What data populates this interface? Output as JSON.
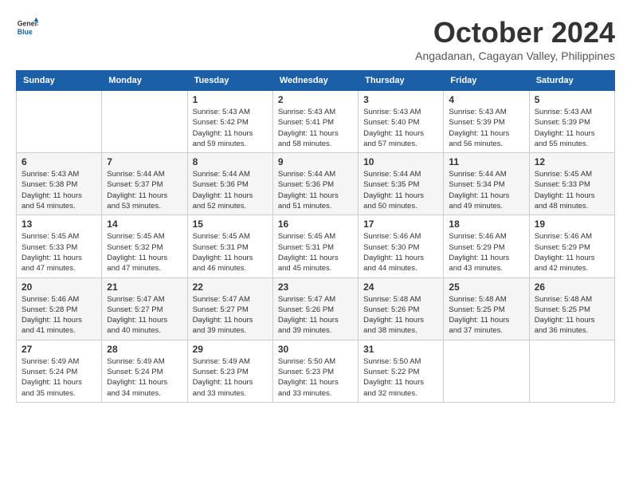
{
  "header": {
    "logo_line1": "General",
    "logo_line2": "Blue",
    "month": "October 2024",
    "location": "Angadanan, Cagayan Valley, Philippines"
  },
  "weekdays": [
    "Sunday",
    "Monday",
    "Tuesday",
    "Wednesday",
    "Thursday",
    "Friday",
    "Saturday"
  ],
  "weeks": [
    [
      {
        "day": "",
        "info": ""
      },
      {
        "day": "",
        "info": ""
      },
      {
        "day": "1",
        "info": "Sunrise: 5:43 AM\nSunset: 5:42 PM\nDaylight: 11 hours and 59 minutes."
      },
      {
        "day": "2",
        "info": "Sunrise: 5:43 AM\nSunset: 5:41 PM\nDaylight: 11 hours and 58 minutes."
      },
      {
        "day": "3",
        "info": "Sunrise: 5:43 AM\nSunset: 5:40 PM\nDaylight: 11 hours and 57 minutes."
      },
      {
        "day": "4",
        "info": "Sunrise: 5:43 AM\nSunset: 5:39 PM\nDaylight: 11 hours and 56 minutes."
      },
      {
        "day": "5",
        "info": "Sunrise: 5:43 AM\nSunset: 5:39 PM\nDaylight: 11 hours and 55 minutes."
      }
    ],
    [
      {
        "day": "6",
        "info": "Sunrise: 5:43 AM\nSunset: 5:38 PM\nDaylight: 11 hours and 54 minutes."
      },
      {
        "day": "7",
        "info": "Sunrise: 5:44 AM\nSunset: 5:37 PM\nDaylight: 11 hours and 53 minutes."
      },
      {
        "day": "8",
        "info": "Sunrise: 5:44 AM\nSunset: 5:36 PM\nDaylight: 11 hours and 52 minutes."
      },
      {
        "day": "9",
        "info": "Sunrise: 5:44 AM\nSunset: 5:36 PM\nDaylight: 11 hours and 51 minutes."
      },
      {
        "day": "10",
        "info": "Sunrise: 5:44 AM\nSunset: 5:35 PM\nDaylight: 11 hours and 50 minutes."
      },
      {
        "day": "11",
        "info": "Sunrise: 5:44 AM\nSunset: 5:34 PM\nDaylight: 11 hours and 49 minutes."
      },
      {
        "day": "12",
        "info": "Sunrise: 5:45 AM\nSunset: 5:33 PM\nDaylight: 11 hours and 48 minutes."
      }
    ],
    [
      {
        "day": "13",
        "info": "Sunrise: 5:45 AM\nSunset: 5:33 PM\nDaylight: 11 hours and 47 minutes."
      },
      {
        "day": "14",
        "info": "Sunrise: 5:45 AM\nSunset: 5:32 PM\nDaylight: 11 hours and 47 minutes."
      },
      {
        "day": "15",
        "info": "Sunrise: 5:45 AM\nSunset: 5:31 PM\nDaylight: 11 hours and 46 minutes."
      },
      {
        "day": "16",
        "info": "Sunrise: 5:45 AM\nSunset: 5:31 PM\nDaylight: 11 hours and 45 minutes."
      },
      {
        "day": "17",
        "info": "Sunrise: 5:46 AM\nSunset: 5:30 PM\nDaylight: 11 hours and 44 minutes."
      },
      {
        "day": "18",
        "info": "Sunrise: 5:46 AM\nSunset: 5:29 PM\nDaylight: 11 hours and 43 minutes."
      },
      {
        "day": "19",
        "info": "Sunrise: 5:46 AM\nSunset: 5:29 PM\nDaylight: 11 hours and 42 minutes."
      }
    ],
    [
      {
        "day": "20",
        "info": "Sunrise: 5:46 AM\nSunset: 5:28 PM\nDaylight: 11 hours and 41 minutes."
      },
      {
        "day": "21",
        "info": "Sunrise: 5:47 AM\nSunset: 5:27 PM\nDaylight: 11 hours and 40 minutes."
      },
      {
        "day": "22",
        "info": "Sunrise: 5:47 AM\nSunset: 5:27 PM\nDaylight: 11 hours and 39 minutes."
      },
      {
        "day": "23",
        "info": "Sunrise: 5:47 AM\nSunset: 5:26 PM\nDaylight: 11 hours and 39 minutes."
      },
      {
        "day": "24",
        "info": "Sunrise: 5:48 AM\nSunset: 5:26 PM\nDaylight: 11 hours and 38 minutes."
      },
      {
        "day": "25",
        "info": "Sunrise: 5:48 AM\nSunset: 5:25 PM\nDaylight: 11 hours and 37 minutes."
      },
      {
        "day": "26",
        "info": "Sunrise: 5:48 AM\nSunset: 5:25 PM\nDaylight: 11 hours and 36 minutes."
      }
    ],
    [
      {
        "day": "27",
        "info": "Sunrise: 5:49 AM\nSunset: 5:24 PM\nDaylight: 11 hours and 35 minutes."
      },
      {
        "day": "28",
        "info": "Sunrise: 5:49 AM\nSunset: 5:24 PM\nDaylight: 11 hours and 34 minutes."
      },
      {
        "day": "29",
        "info": "Sunrise: 5:49 AM\nSunset: 5:23 PM\nDaylight: 11 hours and 33 minutes."
      },
      {
        "day": "30",
        "info": "Sunrise: 5:50 AM\nSunset: 5:23 PM\nDaylight: 11 hours and 33 minutes."
      },
      {
        "day": "31",
        "info": "Sunrise: 5:50 AM\nSunset: 5:22 PM\nDaylight: 11 hours and 32 minutes."
      },
      {
        "day": "",
        "info": ""
      },
      {
        "day": "",
        "info": ""
      }
    ]
  ]
}
